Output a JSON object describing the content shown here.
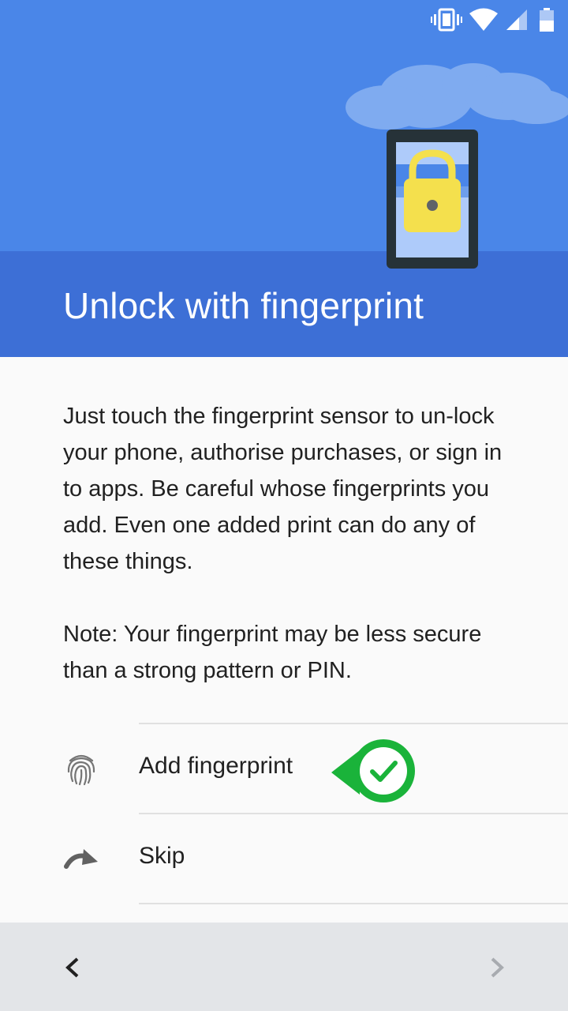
{
  "status_bar": {
    "icons": [
      "vibrate-icon",
      "wifi-icon",
      "signal-icon",
      "battery-icon"
    ]
  },
  "header": {
    "title": "Unlock with fingerprint",
    "colors": {
      "sky": "#4a86e8",
      "band": "#3d6fd6",
      "lock": "#f4e04d"
    }
  },
  "content": {
    "description": "Just touch the fingerprint sensor to un-lock your phone, authorise purchases, or sign in to apps. Be careful whose fingerprints you add. Even one added print can do any of these things.",
    "note": "Note: Your fingerprint may be less secure than a strong pattern or PIN."
  },
  "options": [
    {
      "label": "Add fingerprint",
      "icon": "fingerprint-icon"
    },
    {
      "label": "Skip",
      "icon": "skip-arrow-icon"
    }
  ],
  "navigation": {
    "back_icon": "chevron-left-icon",
    "next_icon": "chevron-right-icon"
  },
  "annotation": {
    "icon": "check-pointer-icon",
    "color": "#1ab33a"
  }
}
